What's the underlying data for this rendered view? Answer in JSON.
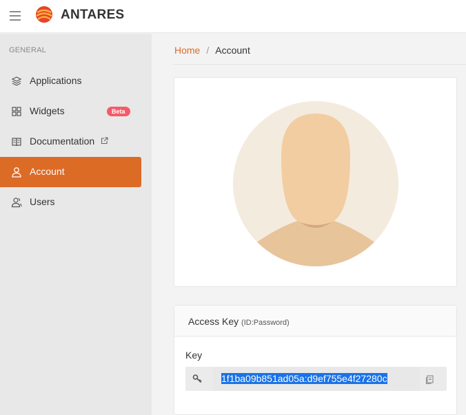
{
  "header": {
    "brand": "ANTARES"
  },
  "sidebar": {
    "section": "GENERAL",
    "items": [
      {
        "label": "Applications",
        "icon": "layers-icon"
      },
      {
        "label": "Widgets",
        "icon": "grid-icon",
        "badge": "Beta"
      },
      {
        "label": "Documentation",
        "icon": "book-icon",
        "external": true
      },
      {
        "label": "Account",
        "icon": "user-icon",
        "active": true
      },
      {
        "label": "Users",
        "icon": "users-icon"
      }
    ]
  },
  "breadcrumb": {
    "home": "Home",
    "current": "Account"
  },
  "access_key": {
    "title": "Access Key",
    "subtitle": "(ID:Password)",
    "key_label": "Key",
    "key_value": "1f1ba09b851ad05a:d9ef755e4f27280c"
  },
  "colors": {
    "accent": "#dc6b26",
    "badge": "#f45b69",
    "selection": "#1a73e8"
  }
}
